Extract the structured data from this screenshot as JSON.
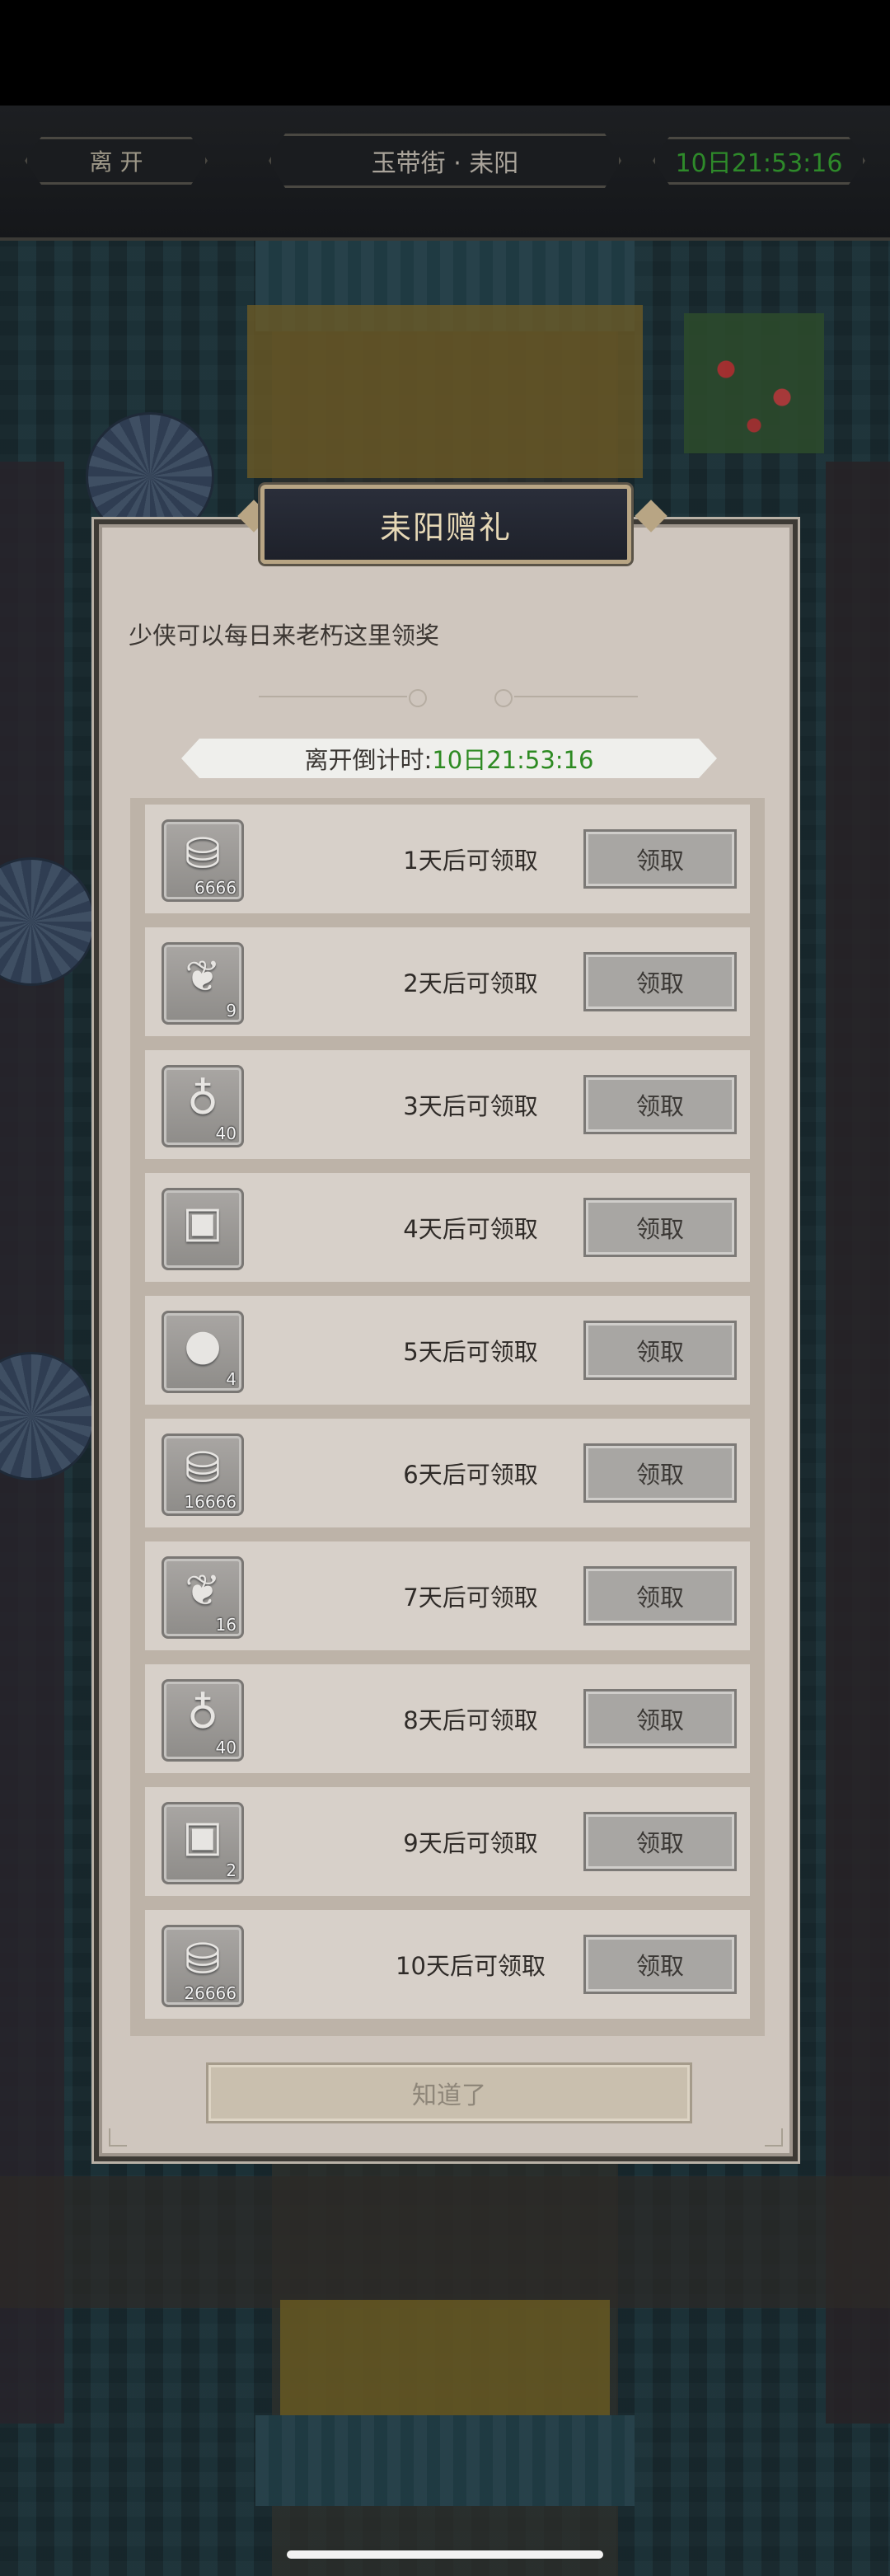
{
  "header": {
    "leave_label": "离 开",
    "location_label": "玉带街 · 耒阳",
    "timer_label": "10日21:53:16"
  },
  "dialog": {
    "title": "耒阳赠礼",
    "subtitle": "少侠可以每日来老朽这里领奖",
    "countdown_label": "离开倒计时:",
    "countdown_value": "10日21:53:16",
    "ok_label": "知道了",
    "rewards": [
      {
        "icon": "silver-ingot-icon",
        "qty": "6666",
        "label": "1天后可领取",
        "button": "领取"
      },
      {
        "icon": "jade-item-icon",
        "qty": "9",
        "label": "2天后可领取",
        "button": "领取"
      },
      {
        "icon": "gourd-icon",
        "qty": "40",
        "label": "3天后可领取",
        "button": "领取"
      },
      {
        "icon": "treasure-chest-icon",
        "qty": "",
        "label": "4天后可领取",
        "button": "领取"
      },
      {
        "icon": "crystal-ball-icon",
        "qty": "4",
        "label": "5天后可领取",
        "button": "领取"
      },
      {
        "icon": "silver-ingot-icon",
        "qty": "16666",
        "label": "6天后可领取",
        "button": "领取"
      },
      {
        "icon": "jade-item-icon",
        "qty": "16",
        "label": "7天后可领取",
        "button": "领取"
      },
      {
        "icon": "gourd-icon",
        "qty": "40",
        "label": "8天后可领取",
        "button": "领取"
      },
      {
        "icon": "treasure-chest-icon",
        "qty": "2",
        "label": "9天后可领取",
        "button": "领取"
      },
      {
        "icon": "silver-ingot-icon",
        "qty": "26666",
        "label": "10天后可领取",
        "button": "领取"
      }
    ]
  },
  "colors": {
    "countdown_value": "#2d8a22",
    "dialog_bg": "#cfc6be",
    "title_bg": "#1e212a",
    "title_text": "#e6d8b6"
  }
}
